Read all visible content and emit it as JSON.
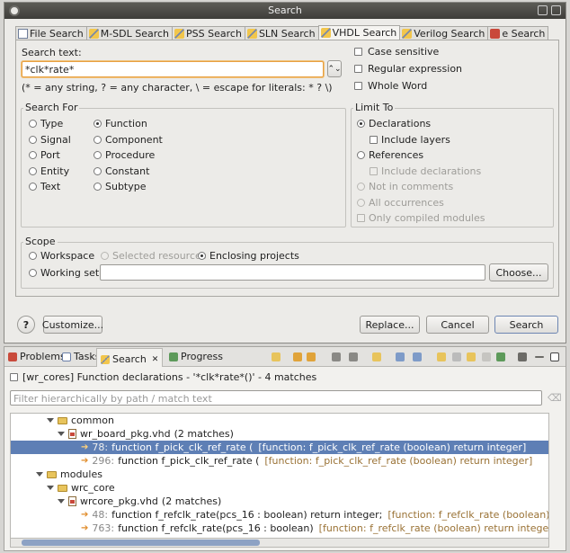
{
  "dialog": {
    "title": "Search",
    "tabs": [
      {
        "label": "File Search",
        "icon": "file-icon"
      },
      {
        "label": "M-SDL Search",
        "icon": "flashlight-icon"
      },
      {
        "label": "PSS Search",
        "icon": "flashlight-icon"
      },
      {
        "label": "SLN Search",
        "icon": "flashlight-icon"
      },
      {
        "label": "VHDL Search",
        "icon": "flashlight-icon"
      },
      {
        "label": "Verilog Search",
        "icon": "flashlight-icon"
      },
      {
        "label": "e Search",
        "icon": "e-language-icon"
      }
    ],
    "active_tab": "VHDL Search",
    "search_text_label": "Search text:",
    "search_text_value": "*clk*rate*",
    "hint": "(* = any string, ? = any character, \\ = escape for literals: * ? \\)",
    "case_sensitive": "Case sensitive",
    "regular_expression": "Regular expression",
    "whole_word": "Whole Word",
    "search_for": {
      "title": "Search For",
      "col1": [
        "Type",
        "Signal",
        "Port",
        "Entity",
        "Text"
      ],
      "col2": [
        "Function",
        "Component",
        "Procedure",
        "Constant",
        "Subtype"
      ],
      "selected": "Function"
    },
    "limit_to": {
      "title": "Limit To",
      "declarations": "Declarations",
      "include_layers": "Include layers",
      "references": "References",
      "include_declarations": "Include declarations",
      "not_in_comments": "Not in comments",
      "all_occurrences": "All occurrences",
      "only_compiled_modules": "Only compiled modules"
    },
    "scope": {
      "title": "Scope",
      "workspace": "Workspace",
      "selected_resources": "Selected resources",
      "enclosing_projects": "Enclosing projects",
      "working_set": "Working set:",
      "working_set_value": "",
      "choose": "Choose..."
    },
    "buttons": {
      "help": "?",
      "customize": "Customize...",
      "replace": "Replace...",
      "cancel": "Cancel",
      "search": "Search"
    }
  },
  "view": {
    "tabs": [
      {
        "label": "Problems",
        "icon": "problems-icon"
      },
      {
        "label": "Tasks",
        "icon": "tasks-icon"
      },
      {
        "label": "Search",
        "icon": "search-icon"
      },
      {
        "label": "Progress",
        "icon": "progress-icon"
      }
    ],
    "active_tab": "Search",
    "close_glyph": "✕",
    "result_line": "[wr_cores] Function declarations - '*clk*rate*()' - 4 matches",
    "filter_placeholder": "Filter hierarchically by path / match text",
    "tree": [
      {
        "kind": "folder",
        "level": 3,
        "label": "common"
      },
      {
        "kind": "file",
        "level": 4,
        "label": "wr_board_pkg.vhd",
        "extra": "(2 matches)"
      },
      {
        "kind": "match",
        "level": 5,
        "line": "78:",
        "text": "function f_pick_clk_ref_rate (",
        "context": "[function: f_pick_clk_ref_rate (boolean) return integer]",
        "selected": true
      },
      {
        "kind": "match",
        "level": 5,
        "line": "296:",
        "text": "function f_pick_clk_ref_rate (",
        "context": "[function: f_pick_clk_ref_rate (boolean) return integer]",
        "selected": false
      },
      {
        "kind": "folder",
        "level": 2,
        "label": "modules"
      },
      {
        "kind": "folder",
        "level": 3,
        "label": "wrc_core"
      },
      {
        "kind": "file",
        "level": 4,
        "label": "wrcore_pkg.vhd",
        "extra": "(2 matches)"
      },
      {
        "kind": "match",
        "level": 5,
        "line": "48:",
        "text": "function f_refclk_rate(pcs_16 : boolean) return integer;",
        "context": "[function: f_refclk_rate (boolean) return integer]",
        "selected": false
      },
      {
        "kind": "match",
        "level": 5,
        "line": "763:",
        "text": "function f_refclk_rate(pcs_16 : boolean)",
        "context": "[function: f_refclk_rate (boolean) return integer]",
        "selected": false
      }
    ]
  },
  "colors": {
    "titlebar": "#4a4945",
    "selection": "#5e7fb5",
    "accent_orange": "#e08c2a"
  }
}
